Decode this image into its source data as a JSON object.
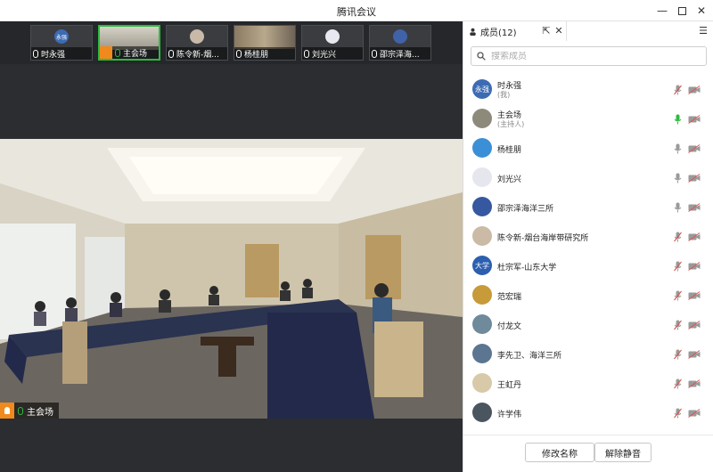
{
  "window": {
    "title": "腾讯会议"
  },
  "thumbnails": [
    {
      "name": "时永强",
      "avatar_text": "永强",
      "color": "#3d6bb3",
      "active": false
    },
    {
      "name": "主会场",
      "color": "#8d8a7c",
      "active": true
    },
    {
      "name": "陈令新-烟...",
      "color": "#c9b9a8",
      "active": false
    },
    {
      "name": "杨桂朋",
      "color": "#6e6356",
      "active": false
    },
    {
      "name": "刘光兴",
      "color": "#e8e8f0",
      "active": false
    },
    {
      "name": "邵宗泽海...",
      "color": "#4062a8",
      "active": false
    }
  ],
  "main_video": {
    "speaker_label": "主会场"
  },
  "panel": {
    "tab_label": "成员(12)",
    "search_placeholder": "搜索成员",
    "members": [
      {
        "name": "时永强",
        "role": "(我)",
        "avatar_text": "永强",
        "color": "#3d6bb3",
        "mic": "muted"
      },
      {
        "name": "主会场",
        "role": "(主持人)",
        "color": "#8d8a7c",
        "mic": "active"
      },
      {
        "name": "杨桂朋",
        "color": "#3b8fd6",
        "mic": "off"
      },
      {
        "name": "刘光兴",
        "color": "#e6e6ee",
        "mic": "off"
      },
      {
        "name": "邵宗泽海洋三所",
        "color": "#3558a0",
        "mic": "off"
      },
      {
        "name": "陈令新-烟台海岸带研究所",
        "color": "#cbbba6",
        "mic": "muted"
      },
      {
        "name": "杜宗军-山东大学",
        "avatar_text": "大学",
        "color": "#2c5fb0",
        "mic": "muted"
      },
      {
        "name": "范宏瑞",
        "color": "#c79a3a",
        "mic": "muted"
      },
      {
        "name": "付龙文",
        "color": "#6f8a9a",
        "mic": "muted"
      },
      {
        "name": "李先卫、海洋三所",
        "color": "#5c7590",
        "mic": "muted"
      },
      {
        "name": "王虹丹",
        "color": "#d8c9a8",
        "mic": "muted"
      },
      {
        "name": "许学伟",
        "color": "#4a5560",
        "mic": "muted"
      }
    ],
    "rename_button": "修改名称",
    "unmute_button": "解除静音"
  },
  "colors": {
    "accent_green": "#2dbb3f",
    "muted_red": "#d9534f",
    "icon_gray": "#9a9a9a"
  }
}
